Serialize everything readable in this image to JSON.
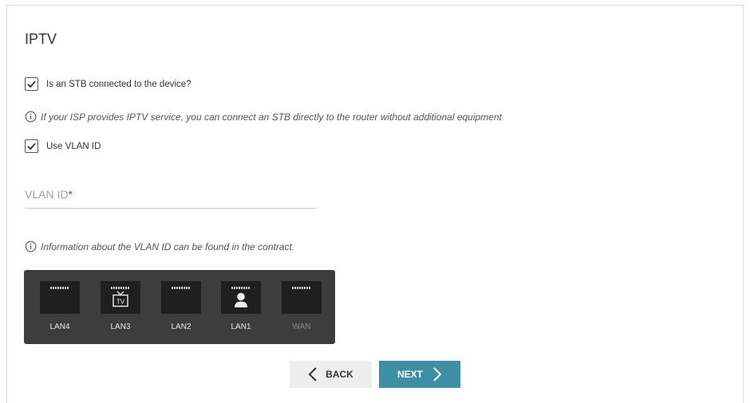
{
  "page": {
    "title": "IPTV"
  },
  "stb_checkbox": {
    "label": "Is an STB connected to the device?",
    "checked": true
  },
  "stb_info": "If your ISP provides IPTV service, you can connect an STB directly to the router without additional equipment",
  "vlan_checkbox": {
    "label": "Use VLAN ID",
    "checked": true
  },
  "vlan_field": {
    "label": "VLAN ID",
    "required_mark": "*",
    "value": ""
  },
  "vlan_info": "Information about the VLAN ID can be found in the contract.",
  "ports": [
    {
      "label": "LAN4",
      "icon": "none",
      "active": true
    },
    {
      "label": "LAN3",
      "icon": "tv-icon",
      "tv_text": "TV",
      "active": true
    },
    {
      "label": "LAN2",
      "icon": "none",
      "active": true
    },
    {
      "label": "LAN1",
      "icon": "user-icon",
      "active": true
    },
    {
      "label": "WAN",
      "icon": "none",
      "active": false
    }
  ],
  "buttons": {
    "back": "BACK",
    "next": "NEXT"
  },
  "colors": {
    "accent": "#3e8fa5",
    "port_panel": "#3d3d3d",
    "required": "#e2231a"
  }
}
